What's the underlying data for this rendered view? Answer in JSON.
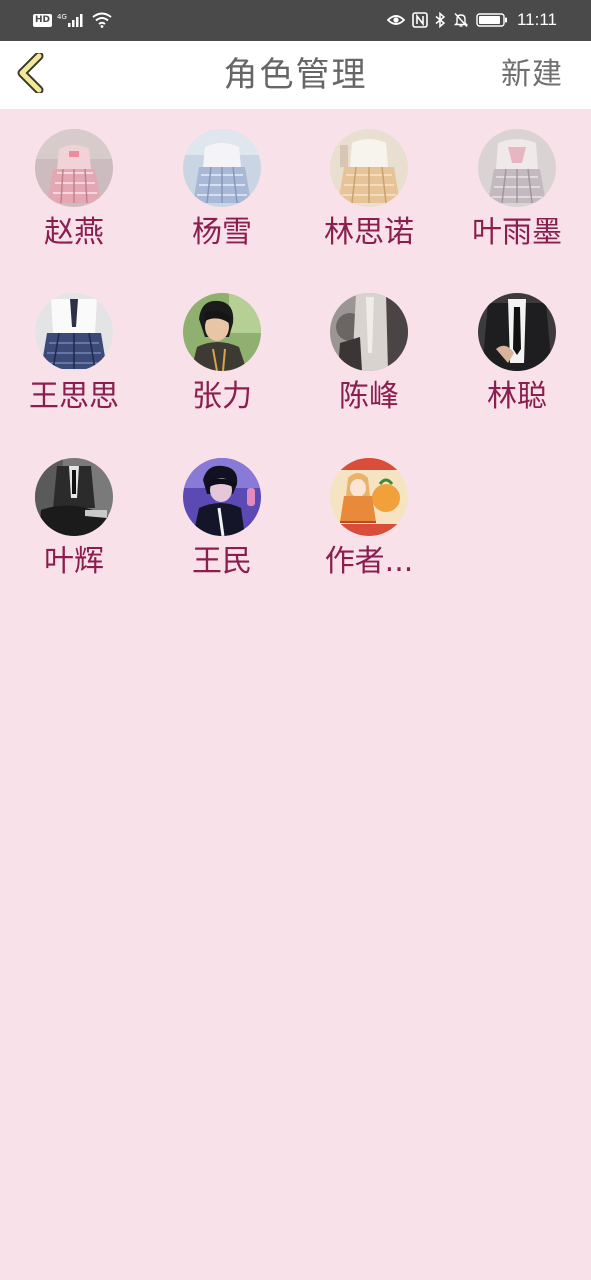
{
  "status_bar": {
    "hd_label": "HD",
    "network_label": "4G",
    "time": "11:11",
    "icons": [
      "signal-icon",
      "wifi-icon",
      "eye-icon",
      "nfc-icon",
      "bluetooth-icon",
      "bell-muted-icon",
      "battery-icon"
    ]
  },
  "header": {
    "back_icon": "chevron-left-icon",
    "title": "角色管理",
    "new_label": "新建"
  },
  "colors": {
    "background": "#f9e1ea",
    "status_bar": "#4a4a4a",
    "header": "#ffffff",
    "name_text": "#8a1f4f",
    "title_text": "#666666",
    "back_icon_fill": "#f3e99a"
  },
  "characters": [
    {
      "name": "赵燕"
    },
    {
      "name": "杨雪"
    },
    {
      "name": "林思诺"
    },
    {
      "name": "叶雨墨"
    },
    {
      "name": "王思思"
    },
    {
      "name": "张力"
    },
    {
      "name": "陈峰"
    },
    {
      "name": "林聪"
    },
    {
      "name": "叶辉"
    },
    {
      "name": "王民"
    },
    {
      "name": "作者..."
    }
  ]
}
